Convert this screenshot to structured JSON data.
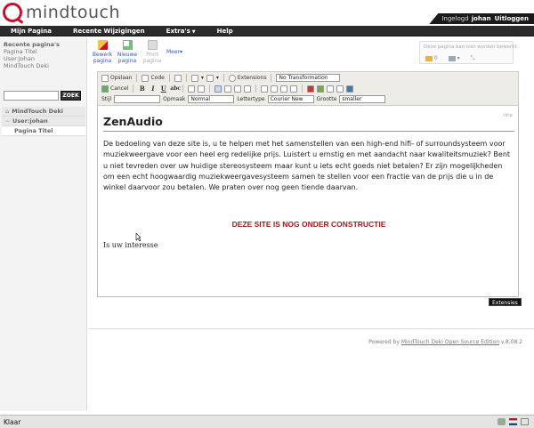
{
  "header": {
    "logo_text": "mindtouch",
    "logged_in_label": "Ingelogd",
    "username": "johan",
    "logout_label": "Uitloggen"
  },
  "nav": {
    "items": [
      {
        "label": "Mijn Pagina"
      },
      {
        "label": "Recente Wijzigingen"
      },
      {
        "label": "Extra's"
      },
      {
        "label": "Help"
      }
    ]
  },
  "sidebar": {
    "recent_title": "Recente pagina's",
    "recent_items": [
      "Pagina Titel",
      "User:Johan",
      "MindTouch Deki"
    ],
    "search_value": "",
    "search_button": "ZOEK",
    "tree": [
      {
        "label": "MindTouch Deki"
      },
      {
        "label": "User:johan"
      },
      {
        "label": "Pagina Titel"
      }
    ]
  },
  "page_toolbar": {
    "edit_label": "Bewerk pagina",
    "new_label": "Nieuwe pagina",
    "print_label": "Print pagina",
    "more_label": "Meer",
    "info_hint": "Deze pagina kan niet worden bewerkt",
    "attachments_count": "0"
  },
  "editor_toolbar": {
    "save": "Opslaan",
    "code": "Code",
    "extensions": "Extensions",
    "transformation": "No Transformation",
    "cancel": "Cancel",
    "style_label": "Stijl",
    "style_value": "",
    "format_label": "Opmaak",
    "format_value": "Normal",
    "font_label": "Lettertype",
    "font_value": "Courier New",
    "size_label": "Grootte",
    "size_value": "smaller"
  },
  "page": {
    "title_tag": "title",
    "heading": "ZenAudio",
    "paragraph": "De bedoeling van deze site is, u te helpen met het samenstellen van een high-end hifi- of surroundsysteem voor muziekweergave voor een heel erg redelijke prijs. Luistert u ernstig en met aandacht naar kwaliteitsmuziek? Bent u niet tevreden over uw huidige stereosysteem maar kunt u iets echt goeds niet betalen? Er zijn mogelijkheden om een echt hoogwaardig muziekweergavesysteem samen te stellen voor een fractie van de prijs die u in de winkel daarvoor zou betalen. We praten over nog geen tiende daarvan.",
    "construction": "DEZE SITE IS NOG ONDER CONSTRUCTIE",
    "interest": "Is uw interesse"
  },
  "extensies_label": "Extensies",
  "footer": {
    "powered_prefix": "Powered by",
    "powered_link": "MindTouch Deki Open Source Edition",
    "version": "v.8.08.2"
  },
  "statusbar": {
    "text": "Klaar"
  },
  "colors": {
    "brand_red": "#c8102e",
    "nav_bg": "#2b2b2b",
    "construction_red": "#9b1b1b"
  }
}
